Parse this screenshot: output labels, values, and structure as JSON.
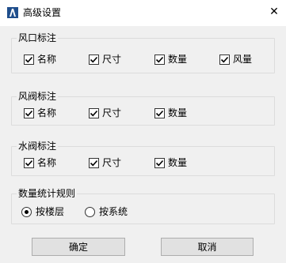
{
  "window": {
    "title": "高级设置",
    "close_glyph": "✕"
  },
  "groups": [
    {
      "title": "风口标注",
      "options": [
        "名称",
        "尺寸",
        "数量",
        "风量"
      ],
      "checked": [
        true,
        true,
        true,
        true
      ]
    },
    {
      "title": "风阀标注",
      "options": [
        "名称",
        "尺寸",
        "数量"
      ],
      "checked": [
        true,
        true,
        true
      ]
    },
    {
      "title": "水阀标注",
      "options": [
        "名称",
        "尺寸",
        "数量"
      ],
      "checked": [
        true,
        true,
        true
      ]
    }
  ],
  "stats_rule": {
    "title": "数量统计规则",
    "options": [
      "按楼层",
      "按系统"
    ],
    "selected": "按楼层"
  },
  "buttons": {
    "ok": "确定",
    "cancel": "取消"
  }
}
